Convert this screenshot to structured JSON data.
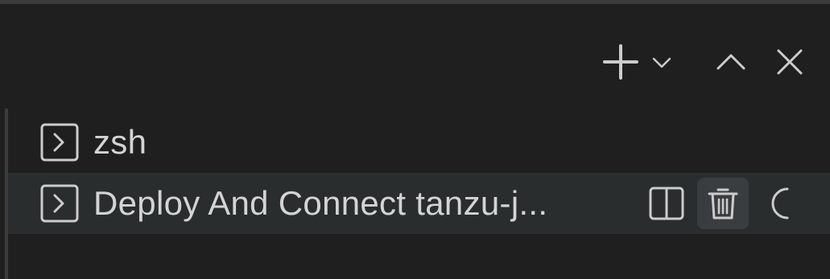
{
  "toolbar": {
    "icons": [
      "plus-icon",
      "chevron-down-icon",
      "chevron-up-icon",
      "close-icon"
    ]
  },
  "terminals": [
    {
      "label": "zsh",
      "icon": "terminal-icon",
      "selected": false
    },
    {
      "label": "Deploy And Connect tanzu-j...",
      "icon": "terminal-icon",
      "selected": true
    }
  ],
  "row_actions": {
    "icons": [
      "split-terminal-icon",
      "trash-icon",
      "loading-spinner-icon"
    ]
  },
  "colors": {
    "background": "#1f1f1f",
    "selected_row": "#2a2d2e",
    "foreground": "#cccccc",
    "text": "#d4d4d4"
  }
}
